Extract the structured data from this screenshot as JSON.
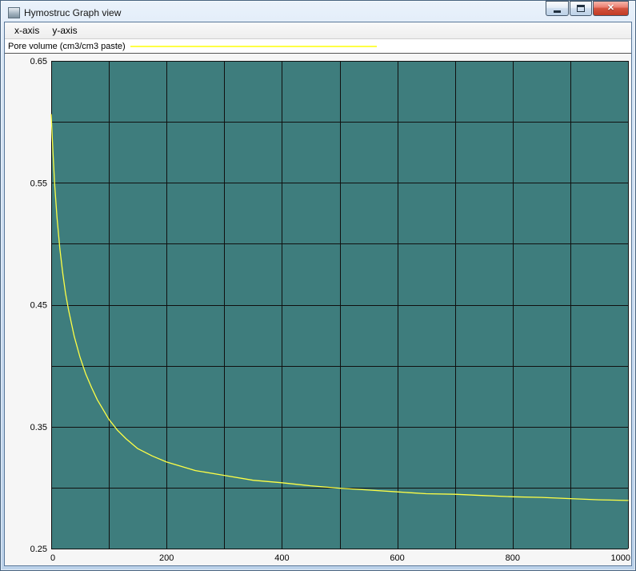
{
  "window": {
    "title": "Hymostruc Graph view",
    "controls": [
      {
        "name": "minimize"
      },
      {
        "name": "maximize"
      },
      {
        "name": "close",
        "glyph": "✕"
      }
    ]
  },
  "menu": {
    "items": [
      {
        "label": "x-axis"
      },
      {
        "label": "y-axis"
      }
    ]
  },
  "legend": {
    "label": "Pore volume (cm3/cm3 paste)",
    "line_color": "#ffff45"
  },
  "chart_data": {
    "type": "line",
    "title": "",
    "xlabel": "",
    "ylabel": "",
    "xlim": [
      0,
      1000
    ],
    "ylim": [
      0.25,
      0.65
    ],
    "x_grid_step": 100,
    "y_grid_step": 0.05,
    "x_tick_labels": [
      0,
      200,
      400,
      600,
      800,
      1000
    ],
    "y_tick_labels": [
      0.65,
      0.55,
      0.45,
      0.35,
      0.25
    ],
    "grid": true,
    "grid_color": "#101010",
    "plot_bg": "#3e7d7d",
    "legend_position": "top",
    "series": [
      {
        "name": "Pore volume (cm3/cm3 paste)",
        "color": "#ffff45",
        "x": [
          0,
          3,
          6,
          10,
          15,
          20,
          25,
          30,
          40,
          50,
          60,
          70,
          80,
          90,
          100,
          115,
          130,
          150,
          175,
          200,
          250,
          300,
          350,
          400,
          450,
          500,
          550,
          600,
          650,
          700,
          750,
          800,
          850,
          900,
          950,
          1000
        ],
        "y": [
          0.606,
          0.575,
          0.549,
          0.522,
          0.496,
          0.476,
          0.459,
          0.446,
          0.424,
          0.407,
          0.393,
          0.382,
          0.372,
          0.364,
          0.356,
          0.347,
          0.34,
          0.332,
          0.326,
          0.321,
          0.314,
          0.31,
          0.306,
          0.304,
          0.3015,
          0.2995,
          0.298,
          0.2965,
          0.295,
          0.2945,
          0.2935,
          0.2925,
          0.292,
          0.291,
          0.29,
          0.2895
        ]
      }
    ]
  }
}
